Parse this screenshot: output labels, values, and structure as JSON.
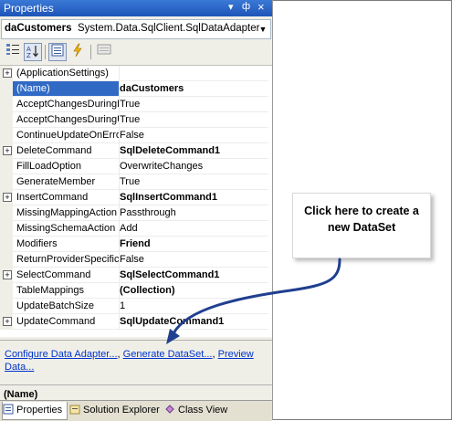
{
  "window": {
    "title": "Properties",
    "dropdown_glyph": "▾",
    "pin_glyph": "ф",
    "close_glyph": "×"
  },
  "object_selector": {
    "name": "daCustomers",
    "type": "System.Data.SqlClient.SqlDataAdapter"
  },
  "toolbar": {
    "icons": [
      "categorized-icon",
      "alphabetical-icon",
      "properties-icon",
      "events-icon",
      "property-pages-icon"
    ]
  },
  "grid": {
    "rows": [
      {
        "expand": "+",
        "name": "(ApplicationSettings)",
        "value": ""
      },
      {
        "expand": "",
        "name": "(Name)",
        "value": "daCustomers"
      },
      {
        "expand": "",
        "name": "AcceptChangesDuringF",
        "value": "True"
      },
      {
        "expand": "",
        "name": "AcceptChangesDuringU",
        "value": "True"
      },
      {
        "expand": "",
        "name": "ContinueUpdateOnErro",
        "value": "False"
      },
      {
        "expand": "+",
        "name": "DeleteCommand",
        "value": "SqlDeleteCommand1"
      },
      {
        "expand": "",
        "name": "FillLoadOption",
        "value": "OverwriteChanges"
      },
      {
        "expand": "",
        "name": "GenerateMember",
        "value": "True"
      },
      {
        "expand": "+",
        "name": "InsertCommand",
        "value": "SqlInsertCommand1"
      },
      {
        "expand": "",
        "name": "MissingMappingAction",
        "value": "Passthrough"
      },
      {
        "expand": "",
        "name": "MissingSchemaAction",
        "value": "Add"
      },
      {
        "expand": "",
        "name": "Modifiers",
        "value": "Friend"
      },
      {
        "expand": "",
        "name": "ReturnProviderSpecific",
        "value": "False"
      },
      {
        "expand": "+",
        "name": "SelectCommand",
        "value": "SqlSelectCommand1"
      },
      {
        "expand": "",
        "name": "TableMappings",
        "value": "(Collection)"
      },
      {
        "expand": "",
        "name": "UpdateBatchSize",
        "value": "1"
      },
      {
        "expand": "+",
        "name": "UpdateCommand",
        "value": "SqlUpdateCommand1"
      }
    ]
  },
  "commands": {
    "configure": "Configure Data Adapter...",
    "sep1": ", ",
    "generate": "Generate DataSet...",
    "sep2": ", ",
    "preview_part1": "Preview",
    "preview_part2": "Data..."
  },
  "description": {
    "title": "(Name)"
  },
  "tabs": [
    {
      "label": "Properties"
    },
    {
      "label": "Solution Explorer"
    },
    {
      "label": "Class View"
    }
  ],
  "callout": {
    "line1": "Click here to create a",
    "line2": "new DataSet"
  },
  "colors": {
    "titlebar": "#1e54b8",
    "selection": "#316ac5",
    "link": "#0033cc",
    "arrow": "#1f3f8f"
  }
}
